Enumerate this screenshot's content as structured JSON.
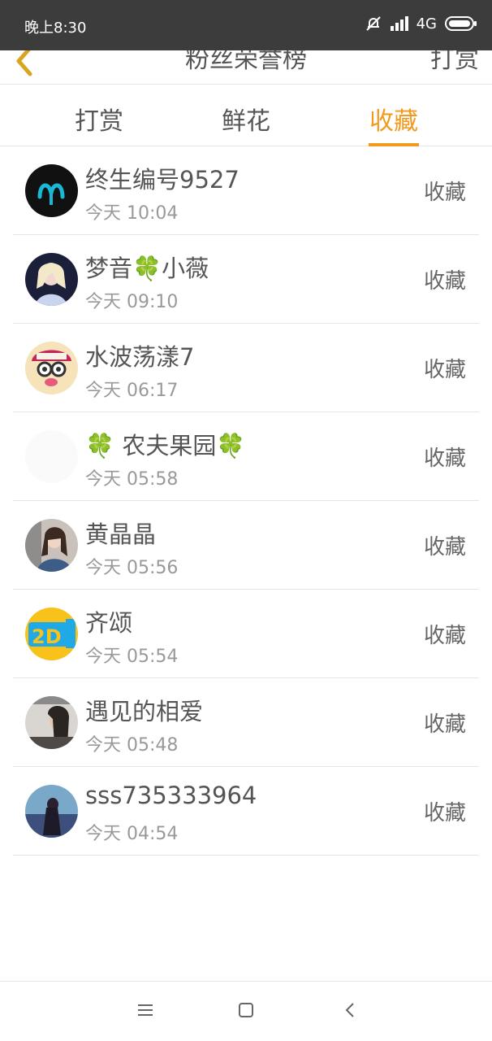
{
  "status_bar": {
    "time": "晚上8:30",
    "network": "4G",
    "icons": [
      "mute-bell-icon",
      "signal-icon",
      "battery-icon"
    ]
  },
  "header": {
    "back_icon": "chevron-left-icon",
    "title": "粉丝荣誉榜",
    "action": "打赏"
  },
  "tabs": [
    {
      "label": "打赏",
      "active": false
    },
    {
      "label": "鲜花",
      "active": false
    },
    {
      "label": "收藏",
      "active": true
    }
  ],
  "accent_color": "#f29a1f",
  "list": [
    {
      "name": "终生编号9527",
      "time": "今天 10:04",
      "action": "收藏"
    },
    {
      "name": "梦音🍀小薇",
      "time": "今天 09:10",
      "action": "收藏"
    },
    {
      "name": "水波荡漾7",
      "time": "今天 06:17",
      "action": "收藏"
    },
    {
      "name": "🍀 农夫果园🍀",
      "time": "今天 05:58",
      "action": "收藏"
    },
    {
      "name": "黄晶晶",
      "time": "今天 05:56",
      "action": "收藏"
    },
    {
      "name": "齐颂",
      "time": "今天 05:54",
      "action": "收藏"
    },
    {
      "name": "遇见的相爱",
      "time": "今天 05:48",
      "action": "收藏"
    },
    {
      "name": "sss735333964",
      "time": "今天 04:54",
      "action": "收藏"
    }
  ],
  "bottom_nav": [
    "menu-icon",
    "home-icon",
    "back-icon"
  ]
}
